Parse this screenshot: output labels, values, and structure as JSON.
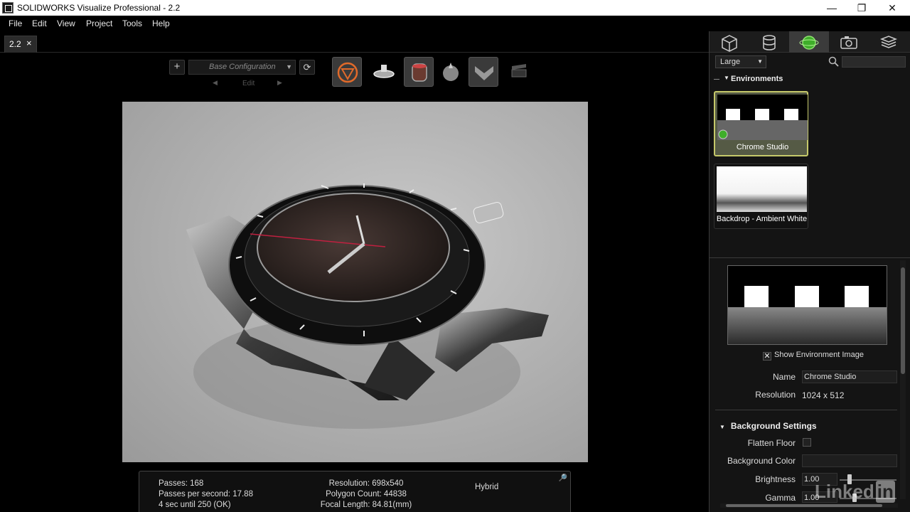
{
  "window": {
    "title": "SOLIDWORKS Visualize Professional - 2.2",
    "controls": {
      "minimize": "—",
      "restore": "❐",
      "close": "✕"
    }
  },
  "menu": [
    "File",
    "Edit",
    "View",
    "Project",
    "Tools",
    "Help"
  ],
  "tab": {
    "label": "2.2",
    "close": "×"
  },
  "toolbar": {
    "add": "+",
    "configuration": "Base Configuration",
    "edit": "Edit",
    "refresh": "⟳"
  },
  "status": {
    "passes": "Passes: 168",
    "passes_per_second": "Passes per second: 17.88",
    "time_remaining": "4 sec until 250 (OK)",
    "resolution": "Resolution: 698x540",
    "polygon_count": "Polygon Count: 44838",
    "focal_length": "Focal Length: 84.81(mm)",
    "mode": "Hybrid"
  },
  "panel": {
    "size_select": "Large",
    "section_environments": "Environments",
    "environments": [
      {
        "name": "Chrome Studio",
        "selected": true
      },
      {
        "name": "Backdrop - Ambient White",
        "selected": false
      }
    ],
    "show_environment_image": "Show Environment Image",
    "show_environment_checked": "✕",
    "name_label": "Name",
    "name_value": "Chrome Studio",
    "resolution_label": "Resolution",
    "resolution_value": "1024 x 512",
    "background_settings": "Background Settings",
    "flatten_floor": "Flatten Floor",
    "background_color": "Background Color",
    "brightness_label": "Brightness",
    "brightness_value": "1.00",
    "gamma_label": "Gamma",
    "gamma_value": "1.00"
  },
  "watermark": {
    "text": "Linked",
    "in": "in"
  },
  "colors": {
    "accent": "#c5c86a",
    "active_tab": "#3b3b3b",
    "background": "#000000"
  }
}
